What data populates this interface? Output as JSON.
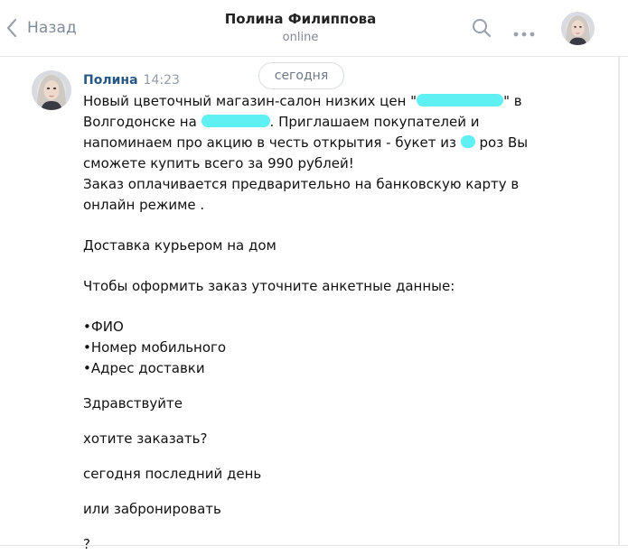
{
  "header": {
    "back_label": "Назад",
    "peer_name": "Полина Филиппова",
    "peer_status": "online",
    "icons": [
      "chevron-left-icon",
      "search-icon",
      "more-icon"
    ]
  },
  "date_separator": "сегодня",
  "message": {
    "author": "Полина",
    "time": "14:23",
    "lines": {
      "l1a": "Новый цветочный магазин-салон низких цен \"",
      "l1b": "\" в",
      "l2a": "Волгодонске на ",
      "l2b": ". Приглашаем покупателей и",
      "l3a": "напоминаем про акцию в честь открытия - букет из ",
      "l3b": " роз Вы",
      "l4": "сможете купить всего за 990 рублей!",
      "l5": "Заказ оплачивается предварительно на банковскую карту в",
      "l6": "онлайн режиме .",
      "l7": "Доставка курьером на дом",
      "l8": "Чтобы оформить заказ уточните анкетные данные:",
      "l9": "•ФИО",
      "l10": "•Номер мобильного",
      "l11": "•Адрес доставки",
      "l12": "Здравствуйте",
      "l13": "хотите заказать?",
      "l14": "сегодня последний день",
      "l15": "или забронировать",
      "l16": "?"
    }
  },
  "colors": {
    "accent_link": "#2a5885",
    "muted": "#818c99",
    "redaction": "#5ef0f3"
  }
}
